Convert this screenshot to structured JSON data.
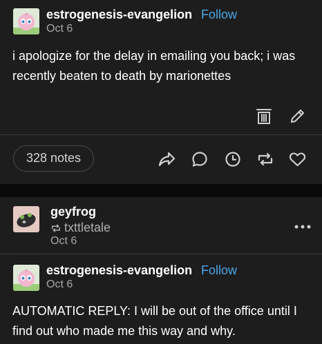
{
  "post1": {
    "username": "estrogenesis-evangelion",
    "follow_label": "Follow",
    "date": "Oct 6",
    "body": "i apologize for the delay in emailing you back; i was recently beaten to death by marionettes",
    "notes_label": "328 notes"
  },
  "reblog": {
    "username": "geyfrog",
    "reblogged_from": "txttletale",
    "date": "Oct 6"
  },
  "post2": {
    "username": "estrogenesis-evangelion",
    "follow_label": "Follow",
    "date": "Oct 6",
    "body": "AUTOMATIC REPLY: I will be out of the office until I find out who made me this way and why."
  },
  "icons": {
    "delete": "trash-icon",
    "edit": "pencil-icon",
    "share": "share-arrow-icon",
    "reply": "speech-bubble-icon",
    "queue": "clock-icon",
    "reblog": "reblog-icon",
    "like": "heart-icon",
    "more": "ellipsis-icon"
  },
  "colors": {
    "background": "#0a0a0a",
    "card": "#1d1d1d",
    "follow_link": "#4aa8e8",
    "muted_text": "#a8a8a8"
  }
}
